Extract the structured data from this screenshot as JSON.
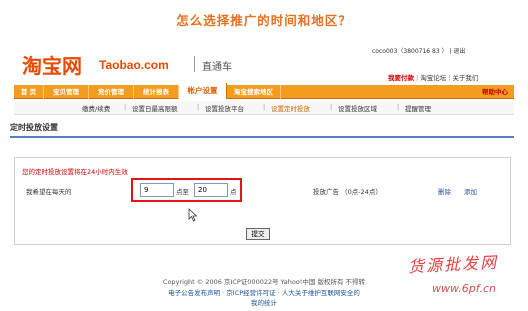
{
  "headline": "怎么选择推广的时间和地区？",
  "header": {
    "logo_cn": "淘宝网",
    "logo_en": "Taobao.com",
    "product": "直通车",
    "user": "coco003（3800716 83 ）  |  退出",
    "links": [
      "我要付款",
      "淘宝论坛",
      "关于我们"
    ]
  },
  "nav": {
    "items": [
      "首 页",
      "宝贝管理",
      "竞价管理",
      "统计报表",
      "帐户设置",
      "淘宝搜索地区"
    ],
    "help": "帮助中心"
  },
  "subnav": {
    "items": [
      "缴费/续费",
      "设置日最高限额",
      "设置投放平台",
      "设置定时投放",
      "设置投放区域",
      "提醒管理"
    ]
  },
  "section": {
    "title": "定时投放设置"
  },
  "form": {
    "notice": "您的定时投放设置将在24小时内生效",
    "label": "我希望在每天的",
    "start_value": "9",
    "unit_to": "点至",
    "end_value": "20",
    "unit_end": "点",
    "range_label": "投放广告 （0点-24点）",
    "delete_label": "删除",
    "add_label": "添加",
    "submit_label": "提交"
  },
  "footer": {
    "line1": "Copyright © 2006 京ICP证000022号 Yahoo!中国 版权所有 不得转",
    "line2": "电子公告发布声明 · 京ICP经营许可证 · 人大关于维护互联网安全的",
    "line3": "我的统计"
  },
  "watermark": {
    "cn": "货源批发网",
    "url": "www.6pf.cn"
  },
  "colors": {
    "accent_orange": "#f39d20",
    "brand_orange": "#e84a00",
    "highlight_red": "#e21515",
    "link_blue": "#1a4f9c",
    "rule_blue": "#5580c0"
  }
}
